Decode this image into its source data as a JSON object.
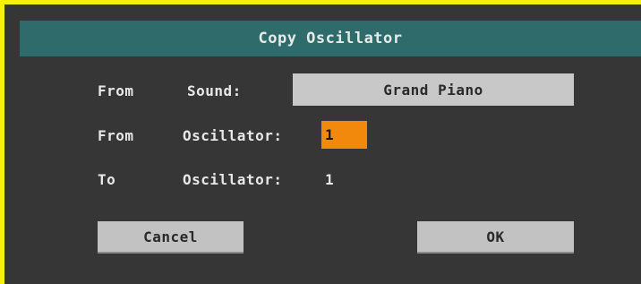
{
  "dialog": {
    "title": "Copy Oscillator"
  },
  "from_sound": {
    "label_from": "From",
    "label_sound": "Sound:",
    "value": "Grand Piano"
  },
  "from_oscillator": {
    "label_from": "From",
    "label_oscillator": "Oscillator:",
    "value": "1"
  },
  "to_oscillator": {
    "label_to": "To",
    "label_oscillator": "Oscillator:",
    "value": "1"
  },
  "buttons": {
    "cancel": "Cancel",
    "ok": "OK"
  },
  "colors": {
    "frame": "#f4f20a",
    "dialog_bg": "#363636",
    "titlebar": "#2e6b6a",
    "field_gray": "#c8c8c8",
    "selected_orange": "#f2880c"
  }
}
